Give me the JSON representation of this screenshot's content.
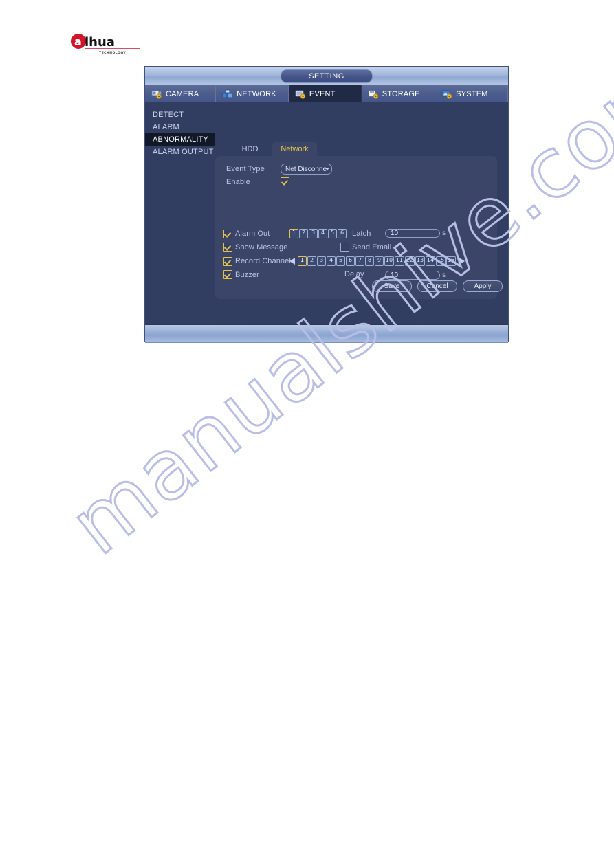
{
  "watermark": {
    "text": "manualshive.com"
  },
  "logo": {
    "brand": "alhua",
    "tagline": "TECHNOLOGY"
  },
  "window": {
    "title": "SETTING",
    "top_tabs": [
      {
        "label": "CAMERA",
        "icon": "camera-gear-icon",
        "active": false
      },
      {
        "label": "NETWORK",
        "icon": "network-icon",
        "active": false
      },
      {
        "label": "EVENT",
        "icon": "event-gear-icon",
        "active": true
      },
      {
        "label": "STORAGE",
        "icon": "storage-gear-icon",
        "active": false
      },
      {
        "label": "SYSTEM",
        "icon": "system-gear-icon",
        "active": false
      }
    ],
    "sidebar": [
      {
        "label": "DETECT",
        "active": false
      },
      {
        "label": "ALARM",
        "active": false
      },
      {
        "label": "ABNORMALITY",
        "active": true
      },
      {
        "label": "ALARM OUTPUT",
        "active": false
      }
    ],
    "subtabs": [
      {
        "label": "HDD",
        "active": false
      },
      {
        "label": "Network",
        "active": true
      }
    ],
    "form": {
      "event_type_label": "Event Type",
      "event_type_value": "Net Disconne",
      "enable_label": "Enable",
      "enable_checked": true,
      "alarm_out_label": "Alarm Out",
      "alarm_out_checked": true,
      "alarm_out_channels": [
        "1",
        "2",
        "3",
        "4",
        "5",
        "6"
      ],
      "alarm_out_selected": [
        "1"
      ],
      "latch_label": "Latch",
      "latch_value": "10",
      "latch_unit": "s",
      "show_message_label": "Show Message",
      "show_message_checked": true,
      "send_email_label": "Send Email",
      "send_email_checked": false,
      "record_channel_label": "Record Channel",
      "record_channel_checked": true,
      "record_channels": [
        "1",
        "2",
        "3",
        "4",
        "5",
        "6",
        "7",
        "8",
        "9",
        "10",
        "11",
        "12",
        "13",
        "14",
        "15",
        "16"
      ],
      "record_channel_selected": [
        "1"
      ],
      "prev_arrow_icon": "arrow-left-icon",
      "next_arrow_icon": "arrow-right-icon",
      "buzzer_label": "Buzzer",
      "buzzer_checked": true,
      "delay_label": "Delay",
      "delay_value": "10",
      "delay_unit": "s"
    },
    "buttons": {
      "save": "Save",
      "cancel": "Cancel",
      "apply": "Apply"
    }
  },
  "colors": {
    "accent_yellow": "#e3c24a",
    "panel_bg": "#3a4568",
    "body_bg": "#323e61",
    "titlebar": "#9eb4d8",
    "active_tab_bg": "#202a45",
    "watermark": "#b9bee6"
  }
}
